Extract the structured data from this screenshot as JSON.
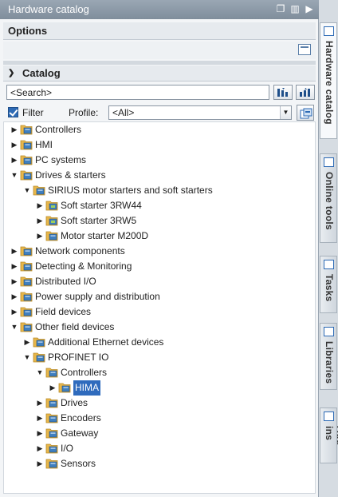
{
  "window": {
    "title": "Hardware catalog"
  },
  "options": {
    "title": "Options"
  },
  "catalog": {
    "title": "Catalog",
    "search_placeholder": "<Search>",
    "filter_label": "Filter",
    "filter_checked": true,
    "profile_label": "Profile:",
    "profile_value": "<All>"
  },
  "tree": [
    {
      "label": "Controllers",
      "level": 0,
      "expanded": false
    },
    {
      "label": "HMI",
      "level": 0,
      "expanded": false
    },
    {
      "label": "PC systems",
      "level": 0,
      "expanded": false
    },
    {
      "label": "Drives & starters",
      "level": 0,
      "expanded": true
    },
    {
      "label": "SIRIUS motor starters and soft starters",
      "level": 1,
      "expanded": true
    },
    {
      "label": "Soft starter 3RW44",
      "level": 2,
      "expanded": false,
      "device": true
    },
    {
      "label": "Soft starter 3RW5",
      "level": 2,
      "expanded": false,
      "device": true
    },
    {
      "label": "Motor starter M200D",
      "level": 2,
      "expanded": false
    },
    {
      "label": "Network components",
      "level": 0,
      "expanded": false
    },
    {
      "label": "Detecting & Monitoring",
      "level": 0,
      "expanded": false
    },
    {
      "label": "Distributed I/O",
      "level": 0,
      "expanded": false
    },
    {
      "label": "Power supply and distribution",
      "level": 0,
      "expanded": false
    },
    {
      "label": "Field devices",
      "level": 0,
      "expanded": false
    },
    {
      "label": "Other field devices",
      "level": 0,
      "expanded": true
    },
    {
      "label": "Additional Ethernet devices",
      "level": 1,
      "expanded": false
    },
    {
      "label": "PROFINET IO",
      "level": 1,
      "expanded": true
    },
    {
      "label": "Controllers",
      "level": 2,
      "expanded": true
    },
    {
      "label": "HIMA",
      "level": 3,
      "expanded": false,
      "selected": true
    },
    {
      "label": "Drives",
      "level": 2,
      "expanded": false
    },
    {
      "label": "Encoders",
      "level": 2,
      "expanded": false
    },
    {
      "label": "Gateway",
      "level": 2,
      "expanded": false
    },
    {
      "label": "I/O",
      "level": 2,
      "expanded": false
    },
    {
      "label": "Sensors",
      "level": 2,
      "expanded": false
    }
  ],
  "side_tabs": [
    {
      "label": "Hardware catalog",
      "icon": "catalog-icon",
      "active": true
    },
    {
      "label": "Online tools",
      "icon": "online-tools-icon",
      "active": false
    },
    {
      "label": "Tasks",
      "icon": "tasks-icon",
      "active": false
    },
    {
      "label": "Libraries",
      "icon": "libraries-icon",
      "active": false
    },
    {
      "label": "Add-ins",
      "icon": "add-ins-icon",
      "active": false
    }
  ],
  "colors": {
    "title_bar": "#8b98a6",
    "selection": "#2f6bbd",
    "folder": "#e8b74a",
    "folder_module": "#3f7fbf"
  }
}
